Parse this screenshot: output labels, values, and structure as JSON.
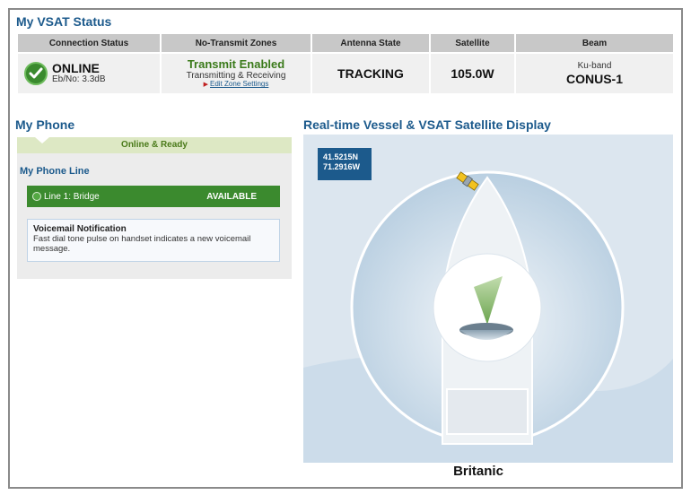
{
  "vsat": {
    "title": "My VSAT Status",
    "headers": {
      "connection": "Connection Status",
      "zones": "No-Transmit Zones",
      "antenna": "Antenna State",
      "satellite": "Satellite",
      "beam": "Beam"
    },
    "connection": {
      "state": "ONLINE",
      "ebno": "Eb/No: 3.3dB"
    },
    "zones": {
      "status": "Transmit Enabled",
      "detail": "Transmitting & Receiving",
      "link": "Edit Zone Settings"
    },
    "antenna_state": "TRACKING",
    "satellite": "105.0W",
    "beam": {
      "band": "Ku-band",
      "name": "CONUS-1"
    }
  },
  "phone": {
    "title": "My Phone",
    "status": "Online & Ready",
    "line_title": "My Phone Line",
    "line": {
      "name": "Line 1: Bridge",
      "status": "AVAILABLE"
    },
    "voicemail": {
      "title": "Voicemail Notification",
      "text": "Fast dial tone pulse on handset indicates a new voicemail message."
    }
  },
  "display": {
    "title": "Real-time Vessel & VSAT Satellite Display",
    "lat": "41.5215N",
    "lon": "71.2916W",
    "vessel_name": "Britanic"
  },
  "colors": {
    "title_blue": "#1c5a8c",
    "online_green": "#3b8a2e",
    "transmit_green": "#3a7a1a"
  },
  "icons": {
    "status": "check-icon",
    "link_arrow": "triangle-right-icon",
    "satellite": "satellite-icon",
    "dish": "antenna-dish-icon"
  }
}
